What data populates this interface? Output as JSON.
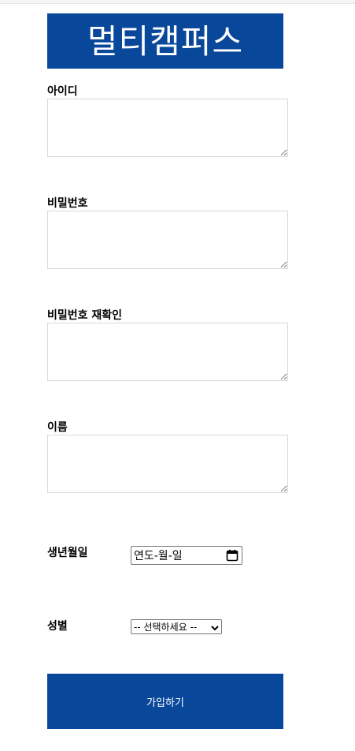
{
  "brand": {
    "title": "멀티캠퍼스",
    "accent_color": "#08479a"
  },
  "form": {
    "id_label": "아이디",
    "id_value": "",
    "password_label": "비밀번호",
    "password_value": "",
    "password_confirm_label": "비밀번호 재확인",
    "password_confirm_value": "",
    "name_label": "이름",
    "name_value": "",
    "birthdate_label": "생년월일",
    "birthdate_placeholder": "연도-월-일",
    "birthdate_icon": "calendar-icon",
    "gender_label": "성별",
    "gender_selected": "-- 선택하세요 --",
    "gender_icon": "chevron-down-icon",
    "submit_label": "가입하기"
  }
}
